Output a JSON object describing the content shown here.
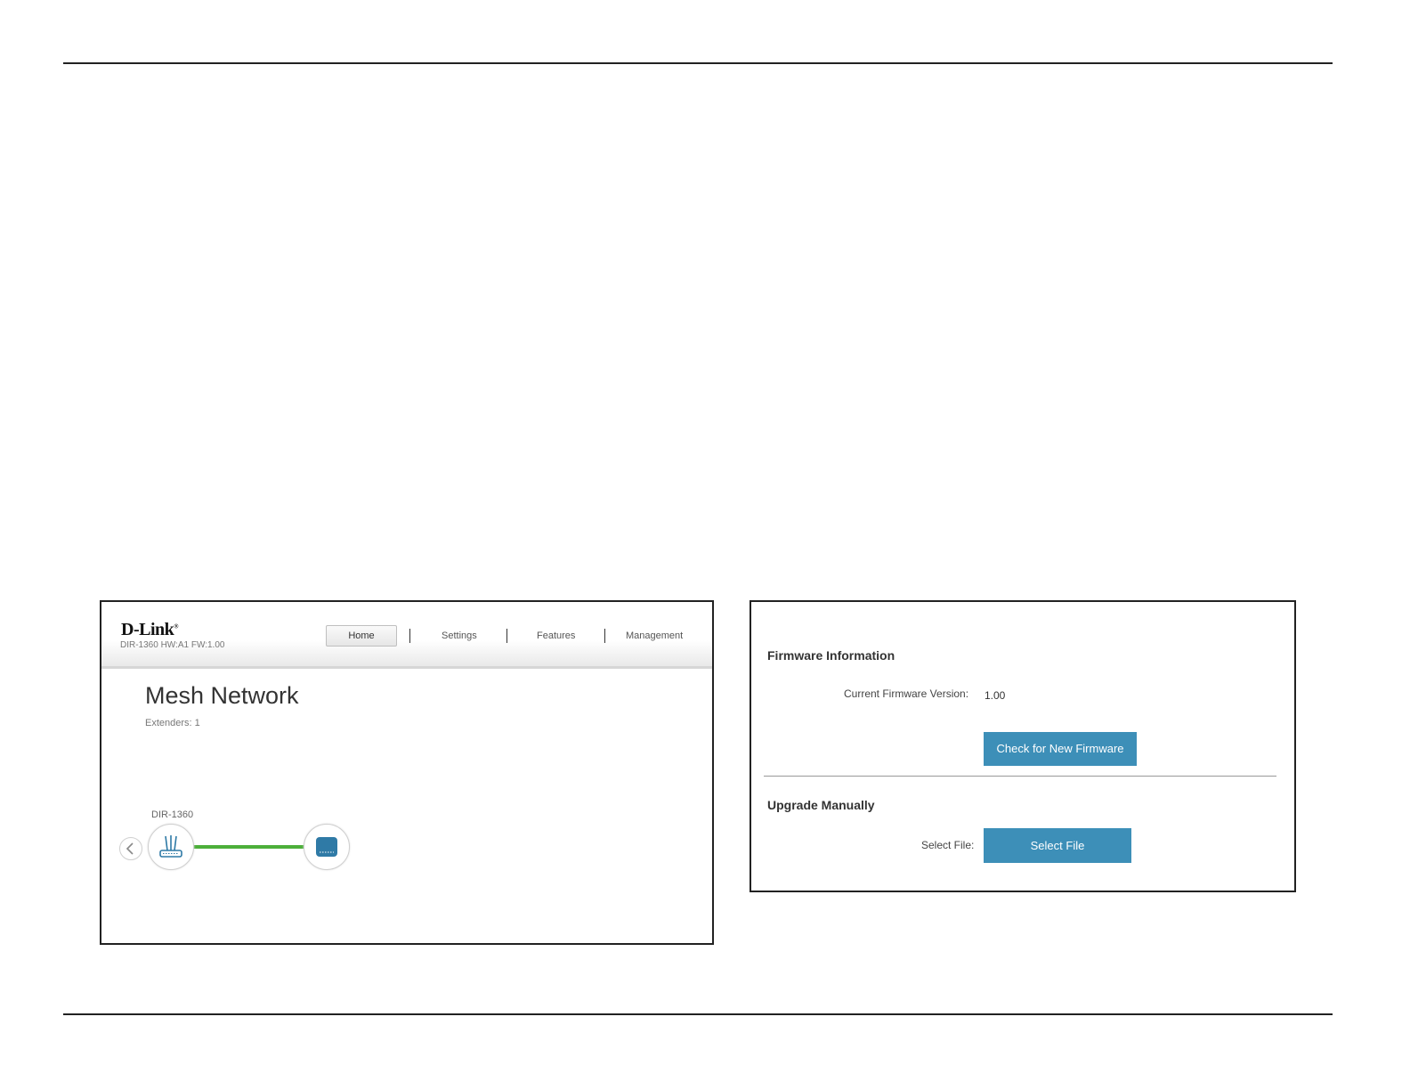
{
  "left_panel": {
    "brand": "D-Link",
    "model_info": "DIR-1360 HW:A1 FW:1.00",
    "nav": [
      "Home",
      "Settings",
      "Features",
      "Management"
    ],
    "page_title": "Mesh Network",
    "extenders_text": "Extenders: 1",
    "device_label": "DIR-1360",
    "link_color": "#4caf3a",
    "icons": [
      "chevron-left-icon",
      "router-icon",
      "extender-icon"
    ]
  },
  "right_panel": {
    "firmware_heading": "Firmware Information",
    "current_fw_label": "Current Firmware Version:",
    "current_fw_value": "1.00",
    "check_button": "Check for New Firmware",
    "upgrade_heading": "Upgrade Manually",
    "select_label": "Select File:",
    "select_button": "Select File",
    "accent_color": "#3d8fb8"
  }
}
